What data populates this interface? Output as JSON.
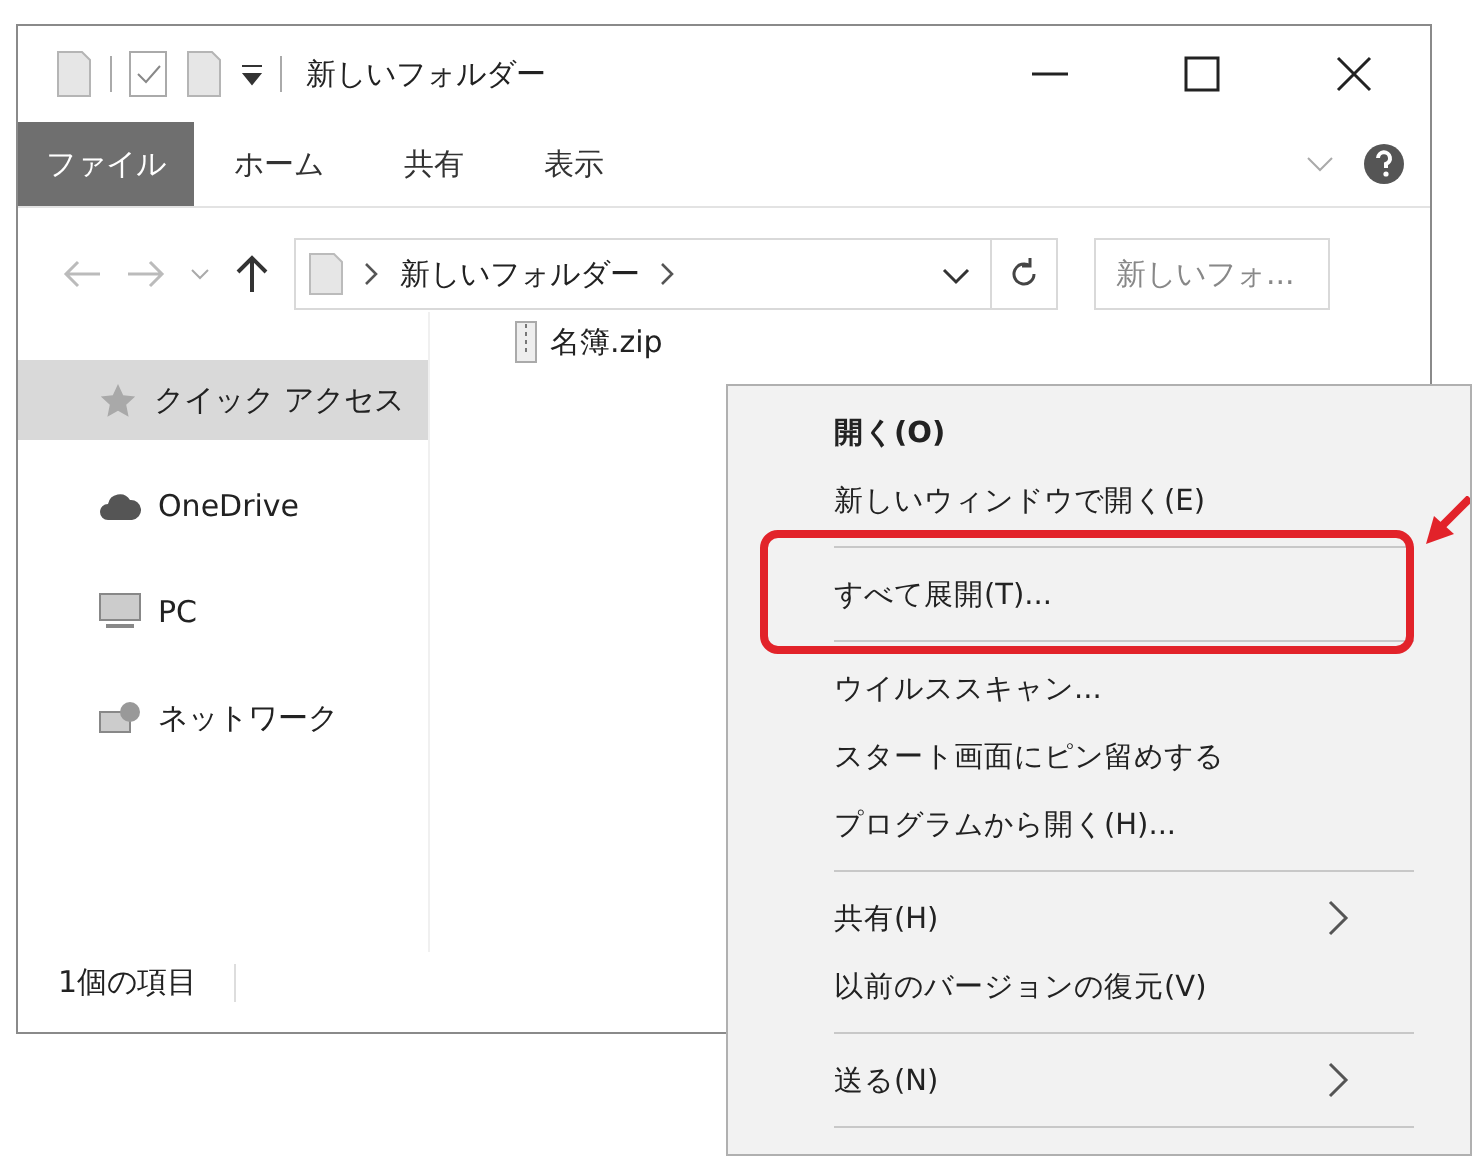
{
  "window": {
    "title": "新しいフォルダー"
  },
  "ribbon": {
    "tabs": [
      {
        "label": "ファイル",
        "kind": "file"
      },
      {
        "label": "ホーム",
        "kind": "tab"
      },
      {
        "label": "共有",
        "kind": "tab"
      },
      {
        "label": "表示",
        "kind": "tab"
      }
    ]
  },
  "address_bar": {
    "path": [
      "新しいフォルダー"
    ],
    "search": {
      "placeholder": "新しいフォ..."
    }
  },
  "navigation": {
    "items": [
      {
        "label": "クイック アクセス",
        "selected": true
      },
      {
        "label": "OneDrive",
        "selected": false
      },
      {
        "label": "PC",
        "selected": false
      },
      {
        "label": "ネットワーク",
        "selected": false
      }
    ]
  },
  "files": [
    {
      "name": "名簿.zip"
    }
  ],
  "status_bar": {
    "item_count": "1個の項目"
  },
  "context_menu": {
    "items": [
      {
        "kind": "item",
        "label": "開く(O)",
        "default": true,
        "submenu": false,
        "annotated": false
      },
      {
        "kind": "item",
        "label": "新しいウィンドウで開く(E)",
        "default": false,
        "submenu": false,
        "annotated": false
      },
      {
        "kind": "separator"
      },
      {
        "kind": "item",
        "label": "すべて展開(T)...",
        "default": false,
        "submenu": false,
        "annotated": true
      },
      {
        "kind": "separator"
      },
      {
        "kind": "item",
        "label": "ウイルススキャン...",
        "default": false,
        "submenu": false,
        "annotated": false
      },
      {
        "kind": "item",
        "label": "スタート画面にピン留めする",
        "default": false,
        "submenu": false,
        "annotated": false
      },
      {
        "kind": "item",
        "label": "プログラムから開く(H)...",
        "default": false,
        "submenu": false,
        "annotated": false
      },
      {
        "kind": "separator"
      },
      {
        "kind": "item",
        "label": "共有(H)",
        "default": false,
        "submenu": true,
        "annotated": false
      },
      {
        "kind": "item",
        "label": "以前のバージョンの復元(V)",
        "default": false,
        "submenu": false,
        "annotated": false
      },
      {
        "kind": "separator"
      },
      {
        "kind": "item",
        "label": "送る(N)",
        "default": false,
        "submenu": true,
        "annotated": false
      },
      {
        "kind": "separator"
      }
    ]
  }
}
